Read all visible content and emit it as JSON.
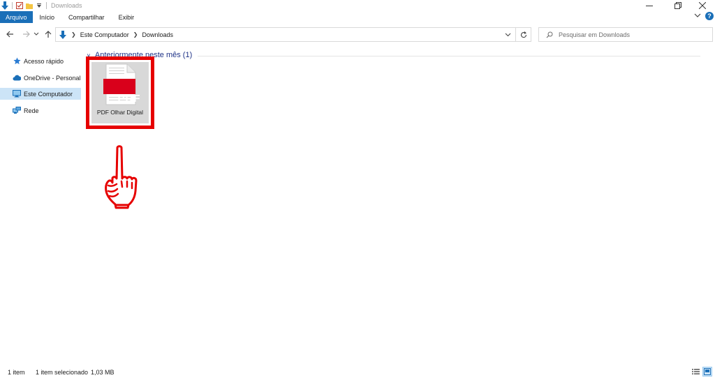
{
  "window": {
    "title": "Downloads",
    "quick_access_icons": [
      "download-arrow-icon",
      "properties-check-icon",
      "new-folder-icon",
      "customize-dropdown-icon"
    ],
    "controls": [
      "minimize-icon",
      "restore-icon",
      "close-icon"
    ]
  },
  "ribbon": {
    "tabs": [
      {
        "label": "Arquivo",
        "active": true
      },
      {
        "label": "Início"
      },
      {
        "label": "Compartilhar"
      },
      {
        "label": "Exibir"
      }
    ],
    "help_label": "?"
  },
  "navigation": {
    "buttons": [
      "back-arrow-icon",
      "forward-arrow-icon",
      "recent-dropdown-icon",
      "up-arrow-icon"
    ],
    "breadcrumb": [
      "Este Computador",
      "Downloads"
    ],
    "search_placeholder": "Pesquisar em Downloads"
  },
  "sidebar": {
    "items": [
      {
        "label": "Acesso rápido",
        "icon": "star-icon"
      },
      {
        "label": "OneDrive - Personal",
        "icon": "cloud-icon"
      },
      {
        "label": "Este Computador",
        "icon": "computer-icon",
        "selected": true
      },
      {
        "label": "Rede",
        "icon": "network-icon"
      }
    ]
  },
  "content": {
    "group_header": "Anteriormente neste mês (1)",
    "files": [
      {
        "name": "PDF Olhar Digital",
        "type_badge": "PDF",
        "selected": true,
        "highlighted": true
      }
    ]
  },
  "statusbar": {
    "item_count": "1 item",
    "selection": "1 item selecionado",
    "size": "1,03 MB"
  },
  "colors": {
    "accent": "#1a6fb8",
    "selection": "#cce4f7",
    "highlight_border": "#e60000",
    "pdf_badge": "#d9001b",
    "group_header": "#1e3287"
  }
}
